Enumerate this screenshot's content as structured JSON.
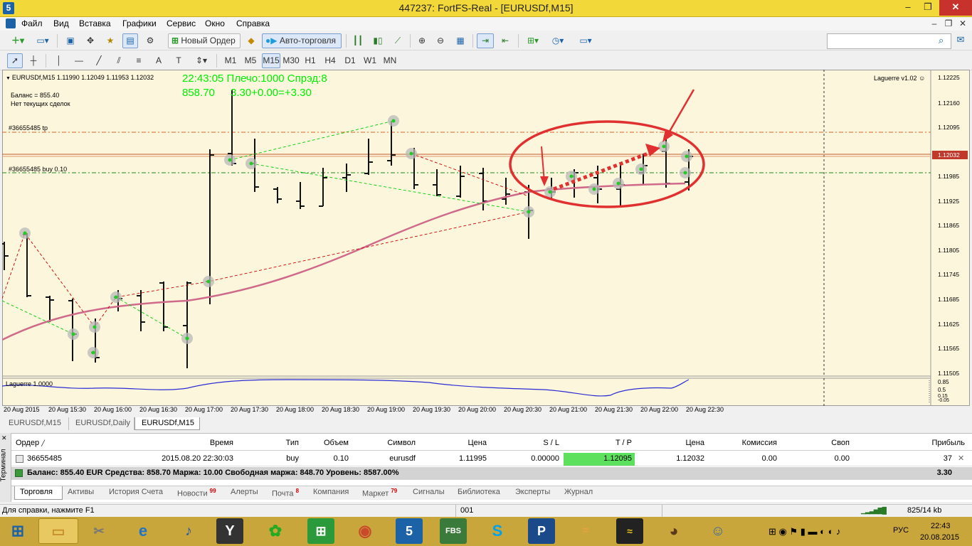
{
  "window": {
    "title": "447237: FortFS-Real - [EURUSDf,M15]"
  },
  "menu": [
    "Файл",
    "Вид",
    "Вставка",
    "Графики",
    "Сервис",
    "Окно",
    "Справка"
  ],
  "toolbar": {
    "new_order": "Новый Ордер",
    "autotrading": "Авто-торговля",
    "timeframes": [
      "M1",
      "M5",
      "M15",
      "M30",
      "H1",
      "H4",
      "D1",
      "W1",
      "MN"
    ],
    "active_timeframe": "M15"
  },
  "chart": {
    "symbol_line": "EURUSDf,M15  1.11990 1.12049 1.11953 1.12032",
    "info_time": "22:43:05 Плечо:1000 Спрэд:8",
    "info_equity": "858.70",
    "info_pl": "3.30+0.00=+3.30",
    "balance_line": "Баланс = 855.40",
    "no_trades_line": "Нет текущих сделок",
    "tp_label": "#36655485 tp",
    "buy_label": "#36655485 buy 0.10",
    "indicator_name": "Laguerre v1.02",
    "sub_label": "Laguerre 1.0000",
    "current_price": "1.12032",
    "y_ticks": [
      "1.12225",
      "1.12160",
      "1.12095",
      "1.12032",
      "1.11985",
      "1.11925",
      "1.11865",
      "1.11805",
      "1.11745",
      "1.11685",
      "1.11625",
      "1.11565",
      "1.11505"
    ],
    "sub_ticks": [
      "0.85",
      "0.5",
      "0.15",
      "-0.05"
    ],
    "x_ticks": [
      "20 Aug 2015",
      "20 Aug 15:30",
      "20 Aug 16:00",
      "20 Aug 16:30",
      "20 Aug 17:00",
      "20 Aug 17:30",
      "20 Aug 18:00",
      "20 Aug 18:30",
      "20 Aug 19:00",
      "20 Aug 19:30",
      "20 Aug 20:00",
      "20 Aug 20:30",
      "20 Aug 21:00",
      "20 Aug 21:30",
      "20 Aug 22:00",
      "20 Aug 22:30"
    ]
  },
  "chart_tabs": [
    "EURUSDf,M15",
    "EURUSDf,Daily",
    "EURUSDf,M15"
  ],
  "terminal": {
    "side_label": "Терминал",
    "headers": [
      "Ордер",
      "Время",
      "Тип",
      "Объем",
      "Символ",
      "Цена",
      "S / L",
      "T / P",
      "Цена",
      "Комиссия",
      "Своп",
      "Прибыль"
    ],
    "row": [
      "36655485",
      "2015.08.20 22:30:03",
      "buy",
      "0.10",
      "eurusdf",
      "1.11995",
      "0.00000",
      "1.12095",
      "1.12032",
      "0.00",
      "0.00",
      "37"
    ],
    "balance": "Баланс: 855.40 EUR  Средства: 858.70  Маржа: 10.00  Свободная маржа: 848.70  Уровень: 8587.00%",
    "balance_profit": "3.30",
    "tabs": [
      {
        "label": "Торговля",
        "badge": ""
      },
      {
        "label": "Активы",
        "badge": ""
      },
      {
        "label": "История Счета",
        "badge": ""
      },
      {
        "label": "Новости",
        "badge": "99"
      },
      {
        "label": "Алерты",
        "badge": ""
      },
      {
        "label": "Почта",
        "badge": "8"
      },
      {
        "label": "Компания",
        "badge": ""
      },
      {
        "label": "Маркет",
        "badge": "79"
      },
      {
        "label": "Сигналы",
        "badge": ""
      },
      {
        "label": "Библиотека",
        "badge": ""
      },
      {
        "label": "Эксперты",
        "badge": ""
      },
      {
        "label": "Журнал",
        "badge": ""
      }
    ]
  },
  "status": {
    "help": "Для справки, нажмите F1",
    "profile": "001",
    "traffic": "825/14 kb"
  },
  "taskbar": {
    "lang": "РУС",
    "time": "22:43",
    "date": "20.08.2015",
    "apps": [
      "FBS"
    ]
  }
}
